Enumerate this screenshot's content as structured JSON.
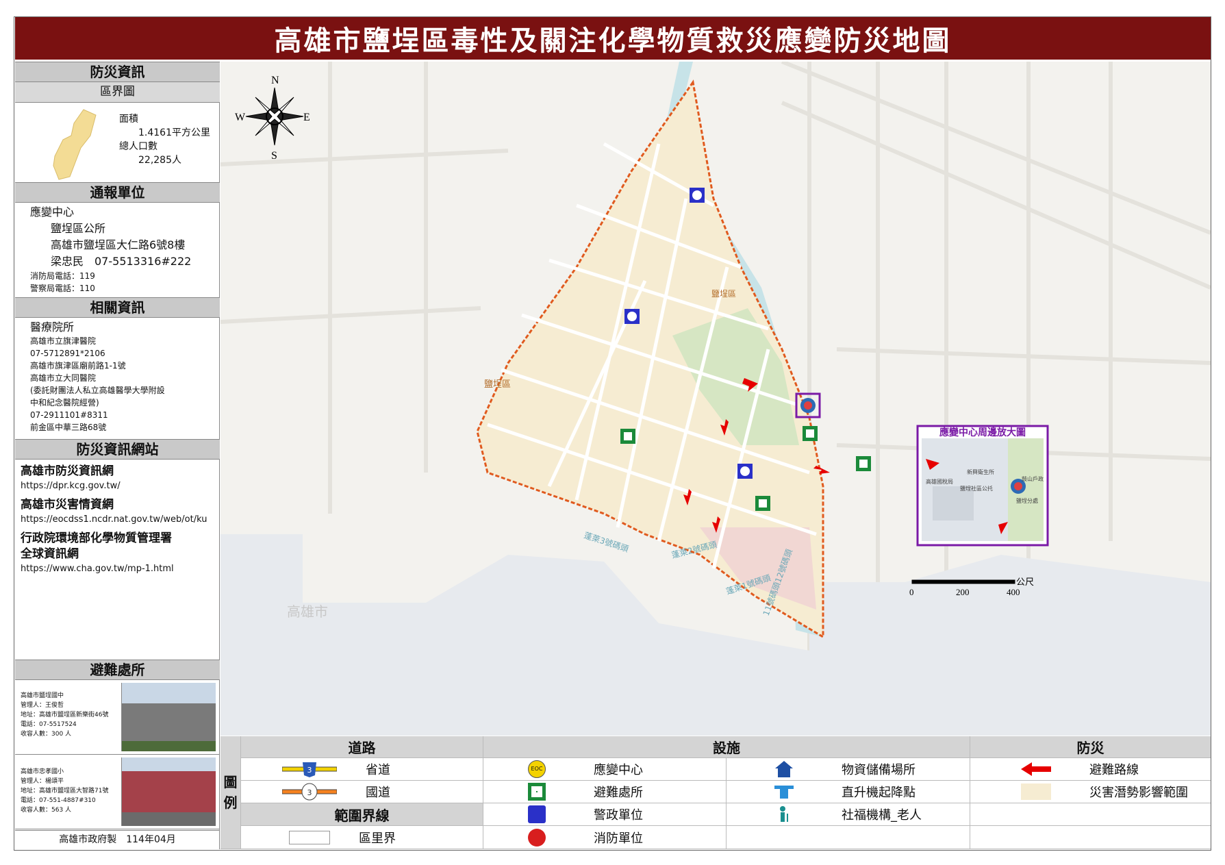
{
  "title": "高雄市鹽埕區毒性及關注化學物質救災應變防災地圖",
  "sidebar": {
    "disaster_info_heading": "防災資訊",
    "district_map_heading": "區界圖",
    "area_label": "面積",
    "area_value": "1.4161平方公里",
    "population_label": "總人口數",
    "population_value": "22,285人",
    "report_unit_heading": "通報單位",
    "response_center_label": "應變中心",
    "response_center_name": "鹽埕區公所",
    "response_center_address": "高雄市鹽埕區大仁路6號8樓",
    "contact_line": "梁忠民　07-5513316#222",
    "fire_phone": "消防局電話：119",
    "police_phone": "警察局電話：110",
    "related_heading": "相關資訊",
    "medical_heading": "醫療院所",
    "medical_lines": [
      "高雄市立旗津醫院",
      "07-5712891*2106",
      "高雄市旗津區廟前路1-1號",
      "高雄市立大同醫院",
      "(委託財團法人私立高雄醫學大學附設",
      "中和紀念醫院經營)",
      "07-2911101#8311",
      "前金區中華三路68號"
    ],
    "websites_heading": "防災資訊網站",
    "sites": [
      {
        "name": "高雄市防災資訊網",
        "url": "https://dpr.kcg.gov.tw/"
      },
      {
        "name": "高雄市災害情資網",
        "url": "https://eocdss1.ncdr.nat.gov.tw/web/ot/ku"
      },
      {
        "name": "行政院環境部化學物質管理署\n全球資訊網",
        "url": "https://www.cha.gov.tw/mp-1.html"
      }
    ],
    "shelter_heading": "避難處所",
    "shelters": [
      {
        "lines": [
          "高雄市鹽埕國中",
          "管理人：王俊哲",
          "地址：高雄市鹽埕區新樂街46號",
          "電話：07-5517524",
          "收容人數：300 人"
        ]
      },
      {
        "lines": [
          "高雄市忠孝國小",
          "管理人：楊頌平",
          "地址：高雄市鹽埕區大智路71號",
          "電話：07-551-4887#310",
          "收容人數：563 人"
        ]
      }
    ],
    "footer": "高雄市政府製　114年04月"
  },
  "map": {
    "compass": {
      "n": "N",
      "s": "S",
      "e": "E",
      "w": "W"
    },
    "labels": {
      "district_name": "鹽埕區",
      "district_name_2": "鹽埕區",
      "city_bottom": "高雄市",
      "city_right": "高雄",
      "pier_3": "蓬萊3號碼頭",
      "pier_2": "蓬萊2號碼頭",
      "pier_1": "蓬萊1號碼頭",
      "pier_12": "11號碼頭12號碼頭"
    },
    "inset_title": "應變中心周邊放大圖",
    "inset_labels": [
      "新興衛生所",
      "高雄國稅局",
      "鹽埕社區公托",
      "鼓山戶政",
      "鹽埕分處"
    ],
    "scale_unit": "公尺",
    "scale_ticks": [
      "0",
      "200",
      "400"
    ],
    "colors": {
      "hazard": "#f6ecd2",
      "boundary": "#e05a1e",
      "river": "#c7e3e8",
      "park": "#d6e6c3",
      "route": "#e60000",
      "title_bg": "#7a1111"
    }
  },
  "legend": {
    "side_label": "圖\n例",
    "road_heading": "道路",
    "facility_heading": "設施",
    "disaster_heading": "防災",
    "boundary_heading": "範圍界線",
    "provincial_road": "省道",
    "provincial_num": "3",
    "national_road": "國道",
    "national_num": "3",
    "village_boundary": "區里界",
    "eoc_badge": "EOC",
    "eoc": "應變中心",
    "shelter": "避難處所",
    "police": "警政單位",
    "fire": "消防單位",
    "storage": "物資儲備場所",
    "helipad": "直升機起降點",
    "elderly": "社福機構_老人",
    "evac_route": "避難路線",
    "hazard_zone": "災害潛勢影響範圍"
  }
}
